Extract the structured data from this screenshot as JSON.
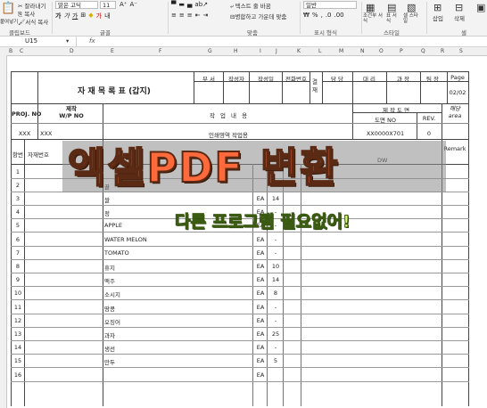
{
  "ribbon": {
    "clipboard_paste": "붙여넣기",
    "clipboard_cut": "잘라내기",
    "clipboard_copy": "복사",
    "clipboard_format": "서식 복사",
    "font_name": "맑은 고딕",
    "font_size": "11",
    "wrap_text": "텍스트 줄 바꿈",
    "merge_center": "병합하고 가운데 맞춤",
    "number_format": "일반",
    "conditional_format": "조건부 서식",
    "format_as_table": "표 서식",
    "cell_styles": "셀 스타일",
    "insert": "삽입",
    "delete": "삭제",
    "groups": {
      "clipboard": "클립보드",
      "font": "글꼴",
      "alignment": "맞춤",
      "number": "표시 형식",
      "styles": "스타일",
      "cells": "셀"
    }
  },
  "formula_bar": {
    "name_box": "U15",
    "fx": "fx"
  },
  "columns": [
    "B",
    "C",
    "D",
    "E",
    "F",
    "G",
    "H",
    "I",
    "J",
    "K",
    "L",
    "M",
    "N",
    "O",
    "P",
    "Q",
    "R",
    "S"
  ],
  "sheet": {
    "title": "자 재 목 록 표 (갑지)",
    "approval": {
      "headers": [
        "부 서",
        "작성자",
        "작성일",
        "전화번호"
      ],
      "gyeoljae": "결재",
      "roles": [
        "담 당",
        "대 리",
        "과 장",
        "팀 장"
      ],
      "page_label": "Page",
      "page_value": "02/02"
    },
    "proj_label": "PROJ. NO",
    "wp_label": "제작\nW/P NO",
    "work_label": "작 업 내 용",
    "drawing_label": "제 작 도 면",
    "drawing_no_label": "도면 NO",
    "rev_label": "REV.",
    "area_label": "해당\narea",
    "proj_value": "XXX",
    "wp_value": "XXX",
    "work_value": "인쇄영역 작업용",
    "drawing_no_value": "XX0000X701",
    "rev_value": "0",
    "remark_label": "Remark",
    "row_no_label": "항번",
    "material_label": "자재번호",
    "dw_label": "DW",
    "items": [
      {
        "no": "1",
        "name": "",
        "unit": "",
        "qty": ""
      },
      {
        "no": "2",
        "name": "꿀",
        "unit": "",
        "qty": ""
      },
      {
        "no": "3",
        "name": "쌀",
        "unit": "EA",
        "qty": "14"
      },
      {
        "no": "4",
        "name": "정",
        "unit": "EA",
        "qty": "-"
      },
      {
        "no": "5",
        "name": "APPLE",
        "unit": "EA",
        "qty": "-"
      },
      {
        "no": "6",
        "name": "WATER MELON",
        "unit": "EA",
        "qty": "-"
      },
      {
        "no": "7",
        "name": "TOMATO",
        "unit": "EA",
        "qty": "-"
      },
      {
        "no": "8",
        "name": "휴지",
        "unit": "EA",
        "qty": "10"
      },
      {
        "no": "9",
        "name": "맥주",
        "unit": "EA",
        "qty": "14"
      },
      {
        "no": "10",
        "name": "소시지",
        "unit": "EA",
        "qty": "8"
      },
      {
        "no": "11",
        "name": "땅콩",
        "unit": "EA",
        "qty": "-"
      },
      {
        "no": "12",
        "name": "오징어",
        "unit": "EA",
        "qty": "-"
      },
      {
        "no": "13",
        "name": "과자",
        "unit": "EA",
        "qty": "25"
      },
      {
        "no": "14",
        "name": "생선",
        "unit": "EA",
        "qty": "-"
      },
      {
        "no": "15",
        "name": "만두",
        "unit": "EA",
        "qty": "5"
      },
      {
        "no": "16",
        "name": "",
        "unit": "EA",
        "qty": ""
      }
    ]
  },
  "overlay": {
    "headline": "엑셀PDF 변환",
    "subline": "다른 프로그램 필요없어!"
  },
  "colors": {
    "headline": "#ff6a3d",
    "subline": "#d9ff73"
  }
}
